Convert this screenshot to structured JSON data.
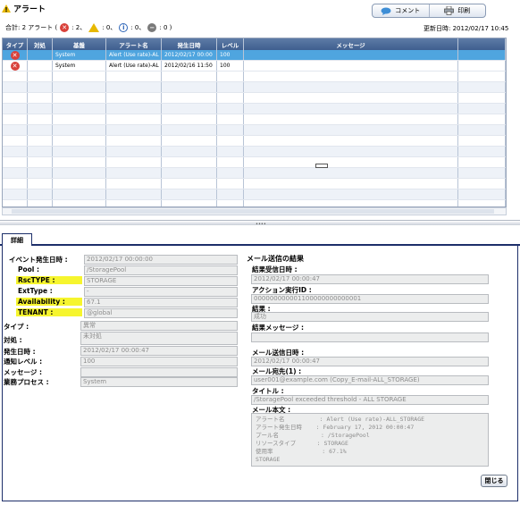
{
  "title": "アラート",
  "toolbar": {
    "comment_label": "コメント",
    "print_label": "印刷"
  },
  "summary": {
    "total_label": "合計: 2 アラート (",
    "error_count": ": 2、",
    "warning_count": ": 0、",
    "info_count": ": 0、",
    "unknown_count": ": 0 )",
    "updated_label": "更新日時: 2012/02/17 10:45"
  },
  "grid": {
    "columns": [
      "タイプ",
      "対処",
      "基盤",
      "アラート名",
      "発生日時",
      "レベル",
      "メッセージ",
      ""
    ],
    "rows": [
      {
        "base": "System",
        "name": "Alert (Use rate)-AL",
        "time": "2012/02/17 00:00",
        "level": "100",
        "message": ""
      },
      {
        "base": "System",
        "name": "Alert (Use rate)-AL",
        "time": "2012/02/16 11:50",
        "level": "100",
        "message": ""
      }
    ]
  },
  "splitter_grip": "••••",
  "detail": {
    "tab_label": "詳細",
    "left": {
      "event_time_label": "イベント発生日時 :",
      "event_time": "2012/02/17 00:00:00",
      "pool_label": "Pool :",
      "pool": "/StoragePool",
      "rsctype_label": "RscTYPE :",
      "rsctype": "STORAGE",
      "exttype_label": "ExtType :",
      "exttype": "-",
      "availability_label": "Availability :",
      "availability": "67.1",
      "tenant_label": "TENANT :",
      "tenant": "@global",
      "type_label": "タイプ :",
      "type": "異常",
      "action_label": "対処 :",
      "action": "未対処",
      "occurred_label": "発生日時 :",
      "occurred": "2012/02/17 00:00:47",
      "notify_level_label": "通知レベル :",
      "notify_level": "100",
      "message_label": "メッセージ :",
      "message": "",
      "process_label": "業務プロセス :",
      "process": "System"
    },
    "right": {
      "section_title": "メール送信の結果",
      "result_time_label": "結果受信日時 :",
      "result_time": "2012/02/17 00:00:47",
      "action_id_label": "アクション実行ID :",
      "action_id": "000000000001100000000000001",
      "result_label": "結果 :",
      "result": "成功",
      "result_message_label": "結果メッセージ :",
      "result_message": "",
      "send_time_label": "メール送信日時 :",
      "send_time": "2012/02/17 00:00:47",
      "mail_to_label": "メール宛先(1) :",
      "mail_to": "user001@example.com (Copy_E-mail-ALL_STORAGE)",
      "mail_title_label": "タイトル :",
      "mail_title": "/StoragePool exceeded threshold - ALL STORAGE",
      "mail_body_label": "メール本文 :",
      "mail_body": "アラート名          : Alert (Use rate)-ALL_STORAGE\nアラート発生日時    : February 17, 2012 00:00:47\nプール名            : /StoragePool\nリソースタイプ      : STORAGE\n使用率              : 67.1%\nSTORAGE"
    },
    "close_label": "閉じる"
  }
}
